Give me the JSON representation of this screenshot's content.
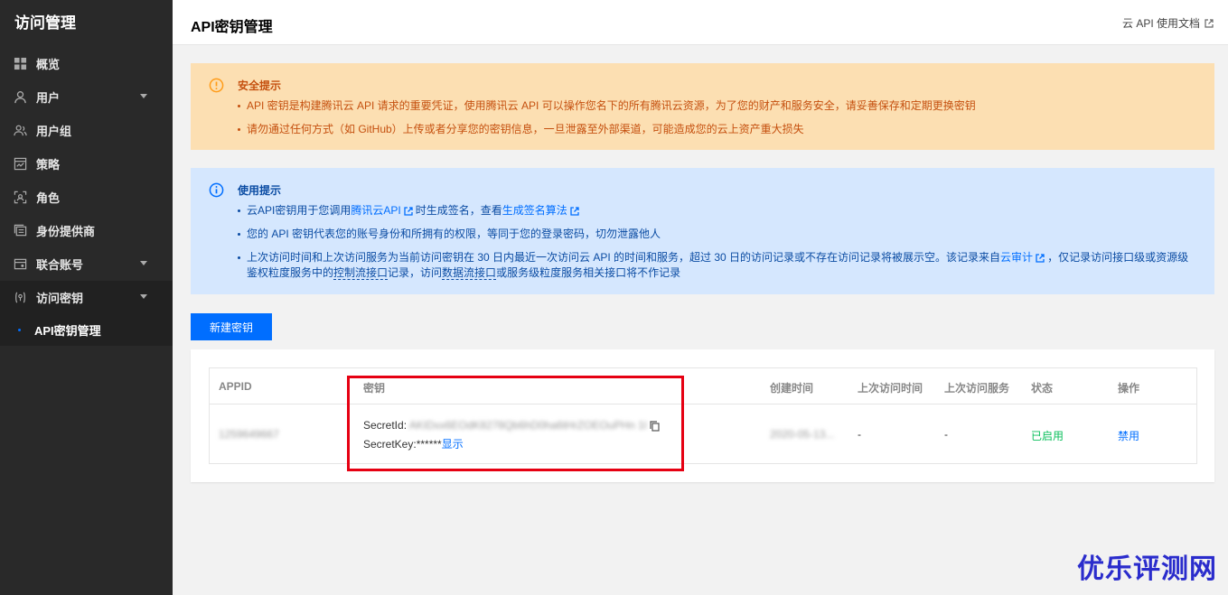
{
  "sidebar": {
    "brand": "访问管理",
    "items": [
      {
        "label": "概览",
        "icon": "dashboard-icon"
      },
      {
        "label": "用户",
        "icon": "user-icon",
        "expandable": true
      },
      {
        "label": "用户组",
        "icon": "user-group-icon"
      },
      {
        "label": "策略",
        "icon": "policy-icon"
      },
      {
        "label": "角色",
        "icon": "role-icon"
      },
      {
        "label": "身份提供商",
        "icon": "identity-provider-icon"
      },
      {
        "label": "联合账号",
        "icon": "federated-account-icon",
        "expandable": true
      },
      {
        "label": "访问密钥",
        "icon": "access-key-icon",
        "expandable": true
      }
    ],
    "sub_item": "API密钥管理",
    "accent": "#006eff"
  },
  "header": {
    "title": "API密钥管理",
    "doc_link": "云 API 使用文档"
  },
  "warning": {
    "title": "安全提示",
    "items": [
      "API 密钥是构建腾讯云 API 请求的重要凭证，使用腾讯云 API 可以操作您名下的所有腾讯云资源，为了您的财产和服务安全，请妥善保存和定期更换密钥",
      "请勿通过任何方式（如 GitHub）上传或者分享您的密钥信息，一旦泄露至外部渠道，可能造成您的云上资产重大损失"
    ]
  },
  "info": {
    "title": "使用提示",
    "item1_prefix": "云API密钥用于您调用",
    "item1_link1": "腾讯云API",
    "item1_mid": "时生成签名，查看",
    "item1_link2": "生成签名算法",
    "item2": "您的 API 密钥代表您的账号身份和所拥有的权限，等同于您的登录密码，切勿泄露他人",
    "item3_prefix": "上次访问时间和上次访问服务为当前访问密钥在 30 日内最近一次访问云 API 的时间和服务，超过 30 日的访问记录或不存在访问记录将被展示空。该记录来自",
    "item3_link": "云审计",
    "item3_mid": "，仅记录访问接口级或资源级鉴权粒度服务中的",
    "item3_dash1": "控制流接口",
    "item3_mid2": "记录，访问",
    "item3_dash2": "数据流接口",
    "item3_suffix": "或服务级粒度服务相关接口将不作记录"
  },
  "new_key_button": "新建密钥",
  "table": {
    "headers": [
      "APPID",
      "密钥",
      "创建时间",
      "上次访问时间",
      "上次访问服务",
      "状态",
      "操作"
    ],
    "row": {
      "appid": "1259649667",
      "secret_id_label": "SecretId:",
      "secret_id_value": "AKIDxx6EOdK8278Qb6hD0ha6tHrZOEOuPHn 1l",
      "secret_key_label": "SecretKey:******",
      "show_label": "显示",
      "created": "2020-05-13...",
      "last_access_time": "-",
      "last_access_service": "-",
      "status": "已启用",
      "action": "禁用"
    }
  },
  "watermark": "优乐评测网",
  "colors": {
    "warn_bg": "#fcdfb2",
    "info_bg": "#d5e7fe",
    "status_green": "#0abf5b",
    "highlight_red": "#e60012"
  }
}
